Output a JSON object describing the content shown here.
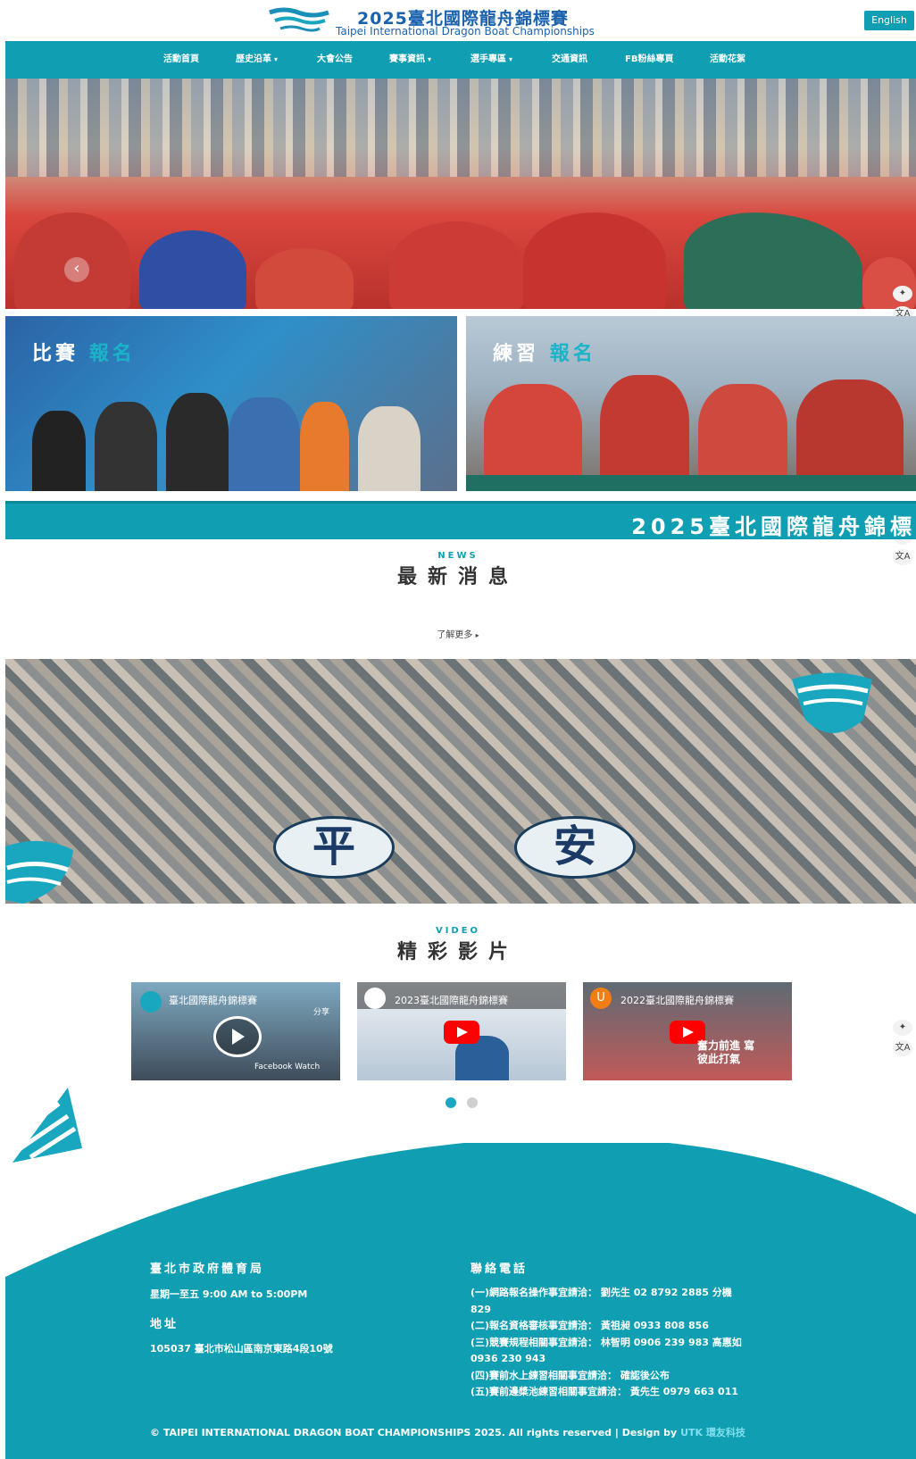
{
  "header": {
    "title_zh": "2025臺北國際龍舟錦標賽",
    "title_en": "Taipei International Dragon Boat Championships",
    "lang_button": "English"
  },
  "nav": [
    {
      "label": "活動首頁",
      "dropdown": false
    },
    {
      "label": "歷史沿革",
      "dropdown": true
    },
    {
      "label": "大會公告",
      "dropdown": false
    },
    {
      "label": "賽事資訊",
      "dropdown": true
    },
    {
      "label": "選手專區",
      "dropdown": true
    },
    {
      "label": "交通資訊",
      "dropdown": false
    },
    {
      "label": "FB粉絲專頁",
      "dropdown": false
    },
    {
      "label": "活動花絮",
      "dropdown": false
    }
  ],
  "icons": {
    "dropdown_caret": "▾",
    "slider_prev": "‹",
    "sparkle": "✦",
    "translate": "文A",
    "more_caret": "▸"
  },
  "cards": {
    "race": {
      "word": "比賽",
      "accent": "報名"
    },
    "practice": {
      "word": "練習",
      "accent": "報名"
    }
  },
  "marquee": "2025臺北國際龍舟錦標",
  "news": {
    "en": "NEWS",
    "zh": "最新消息",
    "more": "了解更多"
  },
  "photo_text": {
    "left": "平",
    "right": "安"
  },
  "video_section": {
    "en": "VIDEO",
    "zh": "精彩影片"
  },
  "videos": [
    {
      "title": "臺北國際龍舟錦標賽",
      "overlay_top": "分享",
      "overlay_bottom": "Facebook Watch",
      "kind": "facebook"
    },
    {
      "title": "2023臺北國際龍舟錦標賽",
      "kind": "youtube"
    },
    {
      "title": "2022臺北國際龍舟錦標賽",
      "overlay_caption": "奮力前進 寫彼此打氣",
      "channel_letter": "U",
      "kind": "youtube"
    }
  ],
  "footer": {
    "org": "臺北市政府體育局",
    "hours": "星期一至五 9:00 AM to 5:00PM",
    "address_heading": "地址",
    "address": "105037 臺北市松山區南京東路4段10號",
    "contact_heading": "聯絡電話",
    "contacts": [
      "(一)網路報名操作事宜請洽： 劉先生 02 8792 2885 分機",
      "829",
      "(二)報名資格審核事宜請洽： 黃祖昶 0933 808 856",
      "(三)競賽規程相關事宜請洽： 林智明 0906 239 983 高惠如",
      "0936 230 943",
      "(四)賽前水上練習相關事宜請洽： 確認後公布",
      "(五)賽前邊槳池練習相關事宜請洽： 黃先生 0979 663 011"
    ],
    "copyright": "© TAIPEI INTERNATIONAL DRAGON BOAT CHAMPIONSHIPS 2025. All rights reserved | Design by",
    "designer": "UTK 環友科技"
  },
  "colors": {
    "primary": "#109fb2",
    "brand_blue": "#1a62ad"
  }
}
